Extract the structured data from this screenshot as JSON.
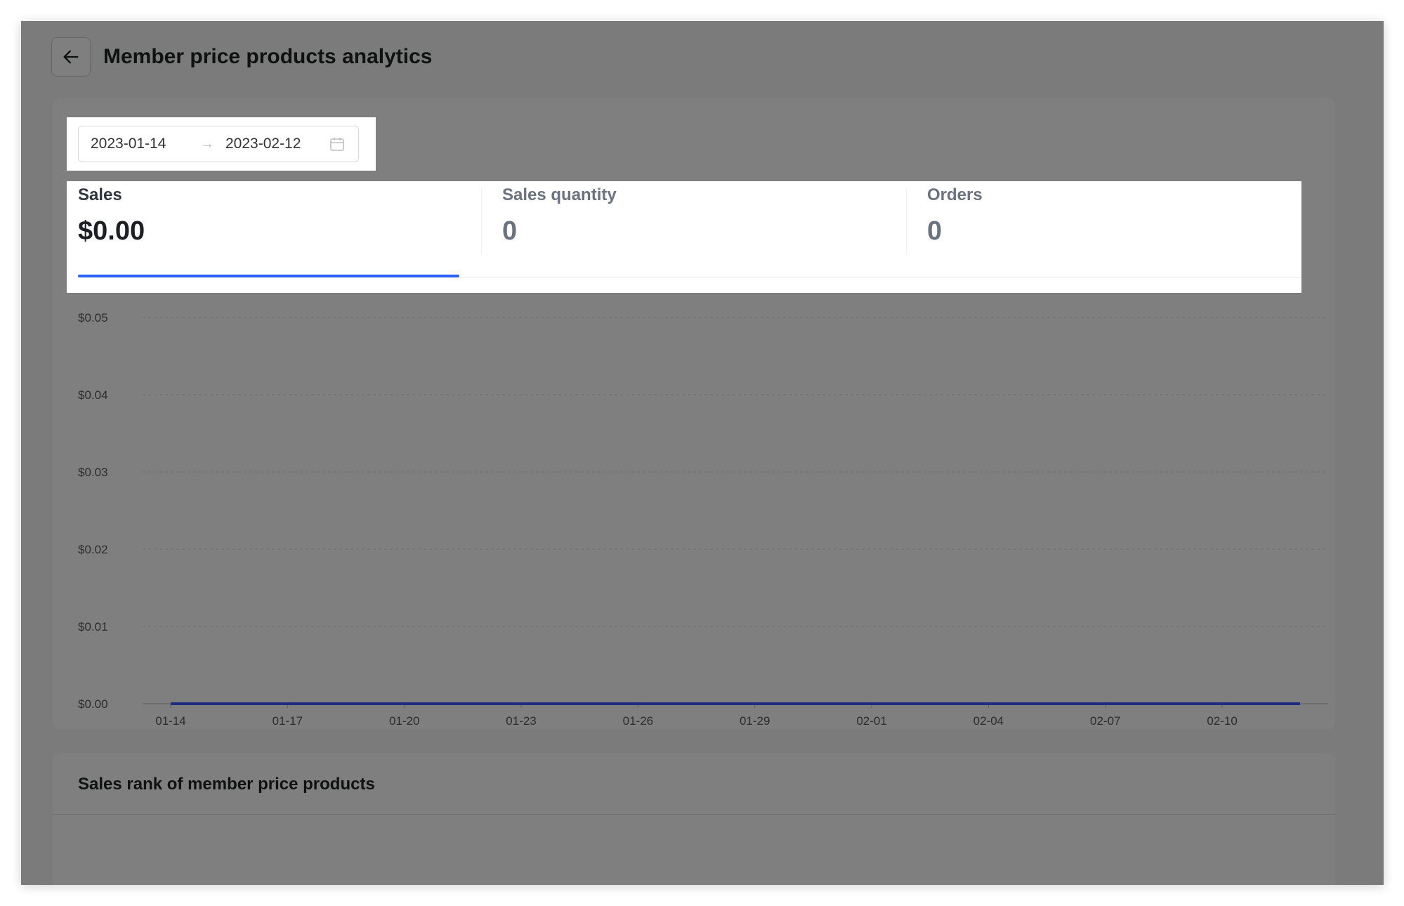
{
  "header": {
    "title": "Member price products analytics",
    "back_icon": "arrow-left-icon"
  },
  "date_range": {
    "start": "2023-01-14",
    "separator": "→",
    "end": "2023-02-12",
    "icon": "calendar-icon"
  },
  "metrics": [
    {
      "label": "Sales",
      "value": "$0.00",
      "active": true
    },
    {
      "label": "Sales quantity",
      "value": "0",
      "active": false
    },
    {
      "label": "Orders",
      "value": "0",
      "active": false
    }
  ],
  "colors": {
    "accent": "#2962ff",
    "line": "#3d5afe"
  },
  "chart_data": {
    "type": "line",
    "x": [
      "01-14",
      "01-15",
      "01-16",
      "01-17",
      "01-18",
      "01-19",
      "01-20",
      "01-21",
      "01-22",
      "01-23",
      "01-24",
      "01-25",
      "01-26",
      "01-27",
      "01-28",
      "01-29",
      "01-30",
      "01-31",
      "02-01",
      "02-02",
      "02-03",
      "02-04",
      "02-05",
      "02-06",
      "02-07",
      "02-08",
      "02-09",
      "02-10",
      "02-11",
      "02-12"
    ],
    "x_tick_labels": [
      "01-14",
      "01-17",
      "01-20",
      "01-23",
      "01-26",
      "01-29",
      "02-01",
      "02-04",
      "02-07",
      "02-10"
    ],
    "series": [
      {
        "values": [
          0,
          0,
          0,
          0,
          0,
          0,
          0,
          0,
          0,
          0,
          0,
          0,
          0,
          0,
          0,
          0,
          0,
          0,
          0,
          0,
          0,
          0,
          0,
          0,
          0,
          0,
          0,
          0,
          0,
          0
        ]
      }
    ],
    "ylim": [
      0,
      0.05
    ],
    "y_tick_labels": [
      "$0.00",
      "$0.01",
      "$0.02",
      "$0.03",
      "$0.04",
      "$0.05"
    ],
    "grid": true
  },
  "rank": {
    "title": "Sales rank of member price products"
  }
}
